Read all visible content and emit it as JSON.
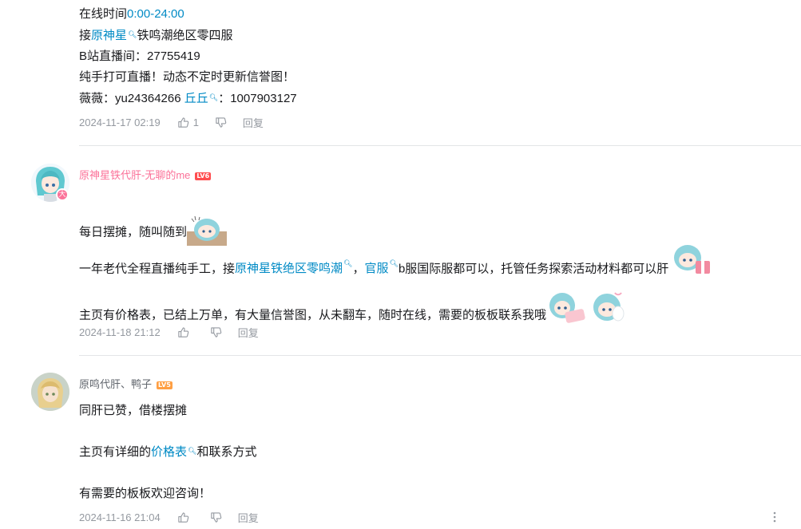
{
  "comment1": {
    "line1_text": "在线时间",
    "line1_link": "0:00-24:00",
    "line2_prefix": "接",
    "line2_link": "原神星",
    "line2_rest": "铁鸣潮绝区零四服",
    "line3": "B站直播间：27755419",
    "line4": "纯手打可直播！动态不定时更新信誉图！",
    "line5_prefix": "薇薇：yu24364266 ",
    "line5_link": "丘丘",
    "line5_rest": "：1007903127",
    "date": "2024-11-17 02:19",
    "like_count": "1",
    "reply_label": "回复"
  },
  "comment2": {
    "username": "原神星铁代肝-无聊的me",
    "level": "LV6",
    "badge": "大",
    "p1": "每日摆摊，随叫随到",
    "p2_prefix": "一年老代全程直播纯手工，接",
    "p2_link1": "原神星铁绝区零鸣潮",
    "p2_sep": "，",
    "p2_link2": "官服",
    "p2_rest": "b服国际服都可以，托管任务探索活动材料都可以肝",
    "p3": "主页有价格表，已结上万单，有大量信誉图，从未翻车，随时在线，需要的板板联系我哦",
    "date": "2024-11-18 21:12",
    "reply_label": "回复"
  },
  "comment3": {
    "username": "原鸣代肝、鸭子",
    "level": "LV5",
    "p1": "同肝已赞，借楼摆摊",
    "p2_prefix": "主页有详细的",
    "p2_link": "价格表",
    "p2_rest": "和联系方式",
    "p3": "有需要的板板欢迎咨询！",
    "date": "2024-11-16 21:04",
    "reply_label": "回复"
  },
  "colors": {
    "link": "#008ac5",
    "meta": "#9499a0",
    "username_pink": "#fb7299",
    "username_plain": "#61666d",
    "lv6": "#ff4d4f",
    "lv5": "#ff9f43"
  },
  "icons": [
    "search-superscript-icon",
    "thumb-up-icon",
    "thumb-down-icon",
    "more-vertical-icon"
  ]
}
